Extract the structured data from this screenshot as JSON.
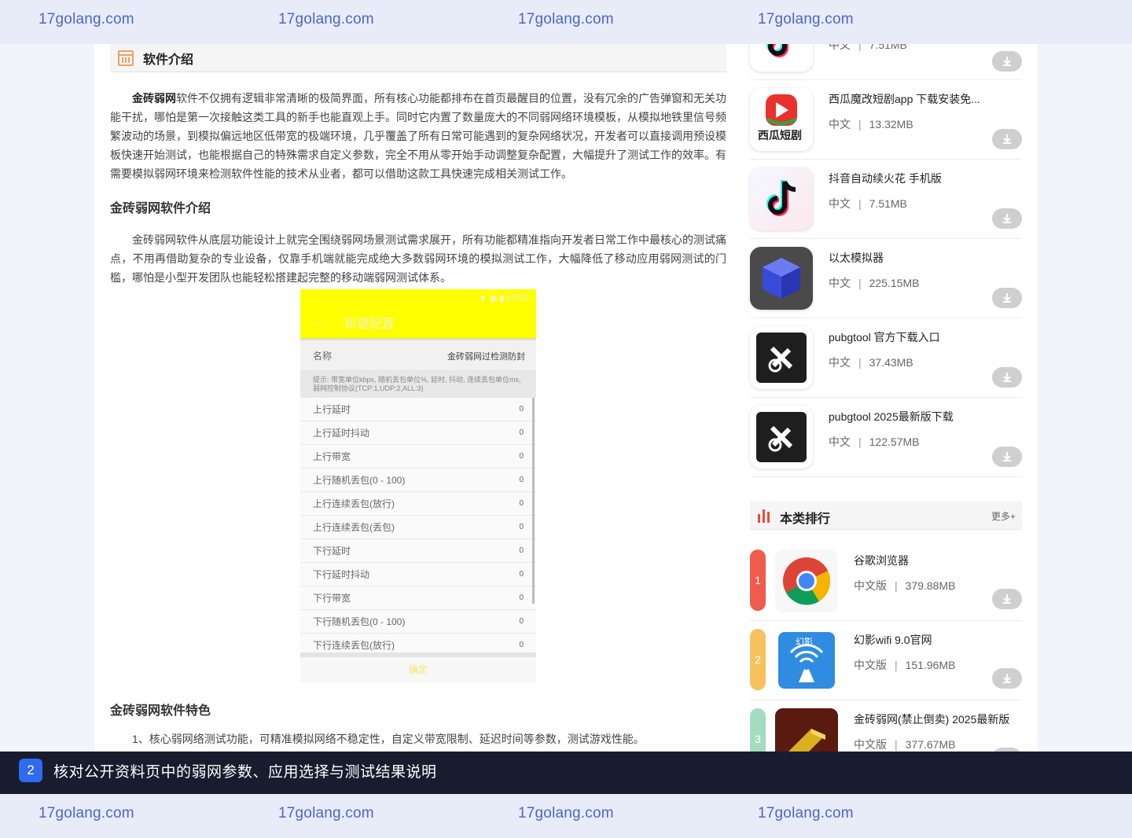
{
  "watermark": {
    "text": "17golang.com"
  },
  "article": {
    "intro_title": "软件介绍",
    "intro_bold": "金砖弱网",
    "intro_text": "软件不仅拥有逻辑非常清晰的极简界面，所有核心功能都排布在首页最醒目的位置，没有冗余的广告弹窗和无关功能干扰，哪怕是第一次接触这类工具的新手也能直观上手。同时它内置了数量庞大的不同弱网络环境模板，从模拟地铁里信号频繁波动的场景，到模拟偏远地区低带宽的极端环境，几乎覆盖了所有日常可能遇到的复杂网络状况，开发者可以直接调用预设模板快速开始测试，也能根据自己的特殊需求自定义参数，完全不用从零开始手动调整复杂配置，大幅提升了测试工作的效率。有需要模拟弱网环境来检测软件性能的技术从业者，都可以借助这款工具快速完成相关测试工作。",
    "h2": "金砖弱网软件介绍",
    "p2": "金砖弱网软件从底层功能设计上就完全围绕弱网场景测试需求展开，所有功能都精准指向开发者日常工作中最核心的测试痛点，不用再借助复杂的专业设备，仅靠手机端就能完成绝大多数弱网环境的模拟测试工作，大幅降低了移动应用弱网测试的门槛，哪怕是小型开发团队也能轻松搭建起完整的移动端弱网测试体系。",
    "h3": "金砖弱网软件特色",
    "feature1": "1、核心弱网络测试功能，可精准模拟网络不稳定性，自定义带宽限制、延迟时间等参数，测试游戏性能。"
  },
  "phone": {
    "status_time": "15:51",
    "appbar_title": "新建配置",
    "name_label": "名称",
    "name_value": "金砖弱网过检测防封",
    "hint": "提示: 带宽单位kbps, 随机丢包单位%, 延时, 抖动, 连续丢包单位ms, 弱网控制协议(TCP:1,UDP:2,ALL:3)",
    "rows": [
      {
        "label": "上行延时",
        "value": "0"
      },
      {
        "label": "上行延时抖动",
        "value": "0"
      },
      {
        "label": "上行带宽",
        "value": "0"
      },
      {
        "label": "上行随机丢包(0 - 100)",
        "value": "0"
      },
      {
        "label": "上行连续丢包(放行)",
        "value": "0"
      },
      {
        "label": "上行连续丢包(丢包)",
        "value": "0"
      },
      {
        "label": "下行延时",
        "value": "0"
      },
      {
        "label": "下行延时抖动",
        "value": "0"
      },
      {
        "label": "下行带宽",
        "value": "0"
      },
      {
        "label": "下行随机丢包(0 - 100)",
        "value": "0"
      },
      {
        "label": "下行连续丢包(放行)",
        "value": "0"
      }
    ],
    "ok": "确定"
  },
  "sidebar": {
    "apps": [
      {
        "title": "",
        "lang": "中文",
        "size": "7.51MB",
        "icon": "tiktok-icon"
      },
      {
        "title": "西瓜魔改短剧app 下载安装免...",
        "lang": "中文",
        "size": "13.32MB",
        "icon": "xigua-icon"
      },
      {
        "title": "抖音自动续火花 手机版",
        "lang": "中文",
        "size": "7.51MB",
        "icon": "tiktok-icon"
      },
      {
        "title": "以太模拟器",
        "lang": "中文",
        "size": "225.15MB",
        "icon": "cube-icon"
      },
      {
        "title": "pubgtool 官方下载入口",
        "lang": "中文",
        "size": "37.43MB",
        "icon": "tool-icon"
      },
      {
        "title": "pubgtool 2025最新版下载",
        "lang": "中文",
        "size": "122.57MB",
        "icon": "tool-icon"
      }
    ],
    "rank_title": "本类排行",
    "rank_more": "更多+",
    "ranks": [
      {
        "num": "1",
        "title": "谷歌浏览器",
        "lang": "中文版",
        "size": "379.88MB",
        "color": "#ef5b4c"
      },
      {
        "num": "2",
        "title": "幻影wifi 9.0官网",
        "lang": "中文版",
        "size": "151.96MB",
        "color": "#f7c25d"
      },
      {
        "num": "3",
        "title": "金砖弱网(禁止倒卖) 2025最新版",
        "lang": "中文版",
        "size": "377.67MB",
        "color": "#a5dcbf"
      }
    ],
    "xigua_text": "西瓜短剧",
    "phantom_text": "幻影"
  },
  "caption": {
    "num": "2",
    "text": "核对公开资料页中的弱网参数、应用选择与测试结果说明"
  }
}
